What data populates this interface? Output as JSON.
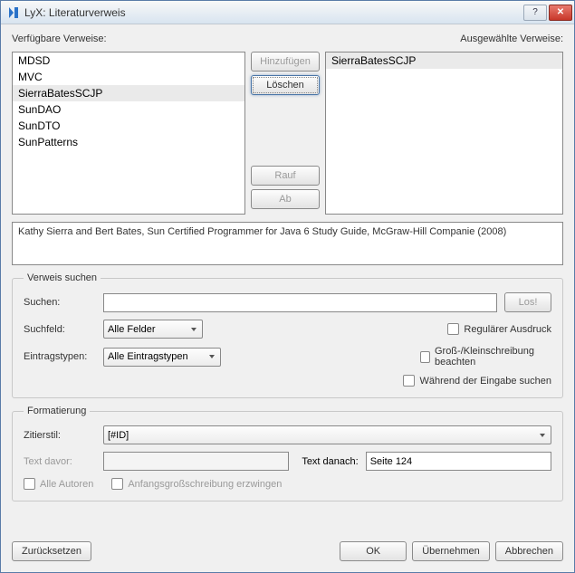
{
  "window": {
    "title": "LyX: Literaturverweis"
  },
  "labels": {
    "available": "Verfügbare Verweise:",
    "selected": "Ausgewählte Verweise:"
  },
  "available_items": [
    "MDSD",
    "MVC",
    "SierraBatesSCJP",
    "SunDAO",
    "SunDTO",
    "SunPatterns"
  ],
  "available_selected_index": 2,
  "selected_items": [
    "SierraBatesSCJP"
  ],
  "mid_buttons": {
    "add": "Hinzufügen",
    "delete": "Löschen",
    "up": "Rauf",
    "down": "Ab"
  },
  "info_text": "Kathy Sierra and Bert Bates, Sun Certified Programmer for Java 6 Study Guide, McGraw-Hill Companie (2008)",
  "search": {
    "legend": "Verweis suchen",
    "search_label": "Suchen:",
    "search_value": "",
    "go": "Los!",
    "field_label": "Suchfeld:",
    "field_value": "Alle Felder",
    "types_label": "Eintragstypen:",
    "types_value": "Alle Eintragstypen",
    "regex": "Regulärer Ausdruck",
    "case": "Groß-/Kleinschreibung beachten",
    "incremental": "Während der Eingabe suchen"
  },
  "format": {
    "legend": "Formatierung",
    "style_label": "Zitierstil:",
    "style_value": "[#ID]",
    "before_label": "Text davor:",
    "before_value": "",
    "after_label": "Text danach:",
    "after_value": "Seite 124",
    "all_authors": "Alle Autoren",
    "force_caps": "Anfangsgroßschreibung erzwingen"
  },
  "buttons": {
    "reset": "Zurücksetzen",
    "ok": "OK",
    "apply": "Übernehmen",
    "cancel": "Abbrechen"
  }
}
